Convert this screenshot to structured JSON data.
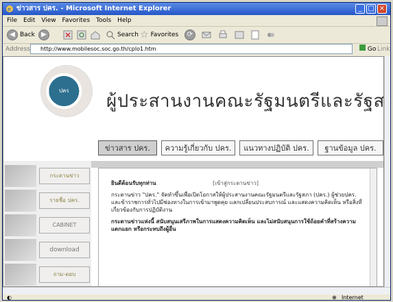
{
  "window": {
    "title": "ข่าวสาร ปคร. - Microsoft Internet Explorer"
  },
  "menu": [
    "File",
    "Edit",
    "View",
    "Favorites",
    "Tools",
    "Help"
  ],
  "toolbar": {
    "back": "Back",
    "search": "Search",
    "favorites": "Favorites"
  },
  "addressbar": {
    "label": "Address",
    "url": "http://www.mobilesoc.soc.go.th/cplo1.htm",
    "go": "Go",
    "links": "Links"
  },
  "page": {
    "seal_text": "ปคร",
    "heading": "ผู้ประสานงานคณะรัฐมนตรีและรัฐสภา",
    "tabs": [
      "ข่าวสาร ปคร.",
      "ความรู้เกี่ยวกับ ปคร.",
      "แนวทางปฏิบัติ ปคร.",
      "ฐานข้อมูล ปคร."
    ],
    "nav": [
      "กระดานข่าว",
      "รายชื่อ ปคร.",
      "CABINET",
      "download",
      "ถาม-ตอบ"
    ],
    "article": {
      "greeting": "ยินดีต้อนรับทุกท่าน",
      "link": "[เข้าสู่กระดานข่าว]",
      "para1": "กระดานข่าว \"ปคร.\" จัดทำขึ้นเพื่อเปิดโอกาสให้ผู้ประสานงานคณะรัฐมนตรีและรัฐสภา (ปคร.) ผู้ช่วยปคร. และข้าราชการทั่วไปมีช่องทางในการเข้ามาพูดคุย แลกเปลี่ยนประสบการณ์ และแสดงความคิดเห็น หรือสิ่งที่เกี่ยวข้องกับการปฏิบัติงาน",
      "para2": "กระดานข่าวแห่งนี้ สนับสนุนเสรีภาพในการแสดงความคิดเห็น และไม่สนับสนุนการใช้ถ้อยคำที่สร้างความแตกแยก หรือกระทบถึงผู้อื่น"
    }
  },
  "status": {
    "zone": "Internet"
  }
}
